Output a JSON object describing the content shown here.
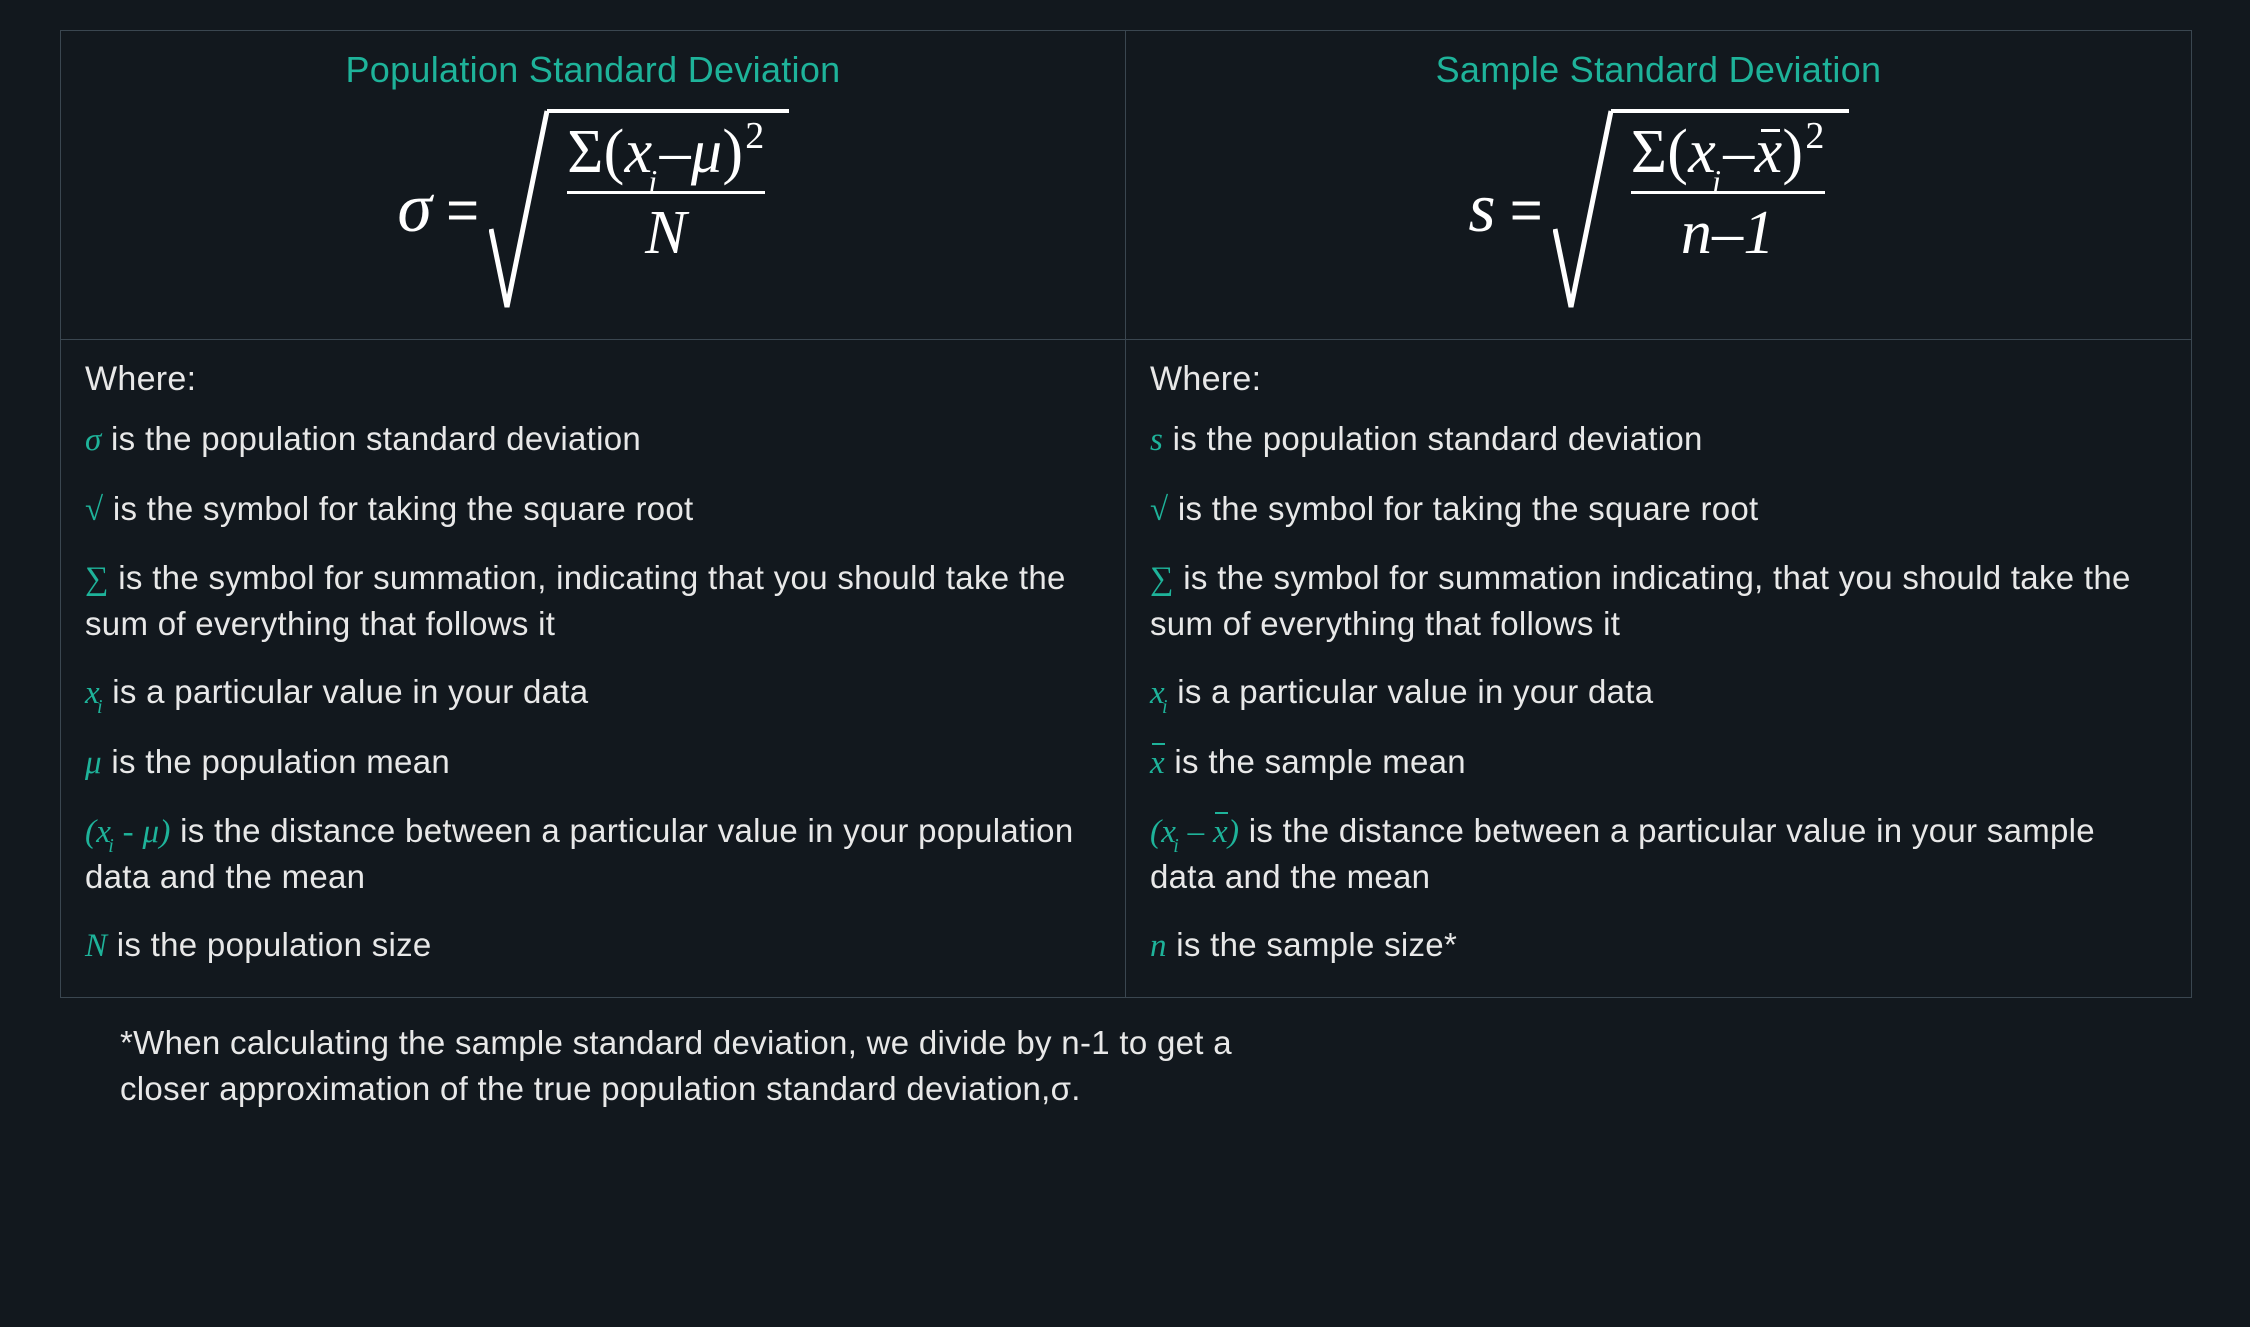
{
  "left": {
    "title": "Population Standard Deviation",
    "formula": {
      "lhs": "σ",
      "eq": "=",
      "numerator_prefix": "Σ(",
      "numerator_var": "x",
      "numerator_sub": "i",
      "numerator_mid": "–",
      "numerator_mean": "μ",
      "numerator_close": ")",
      "numerator_sup": "2",
      "denominator": "N"
    },
    "where_label": "Where:",
    "definitions": [
      {
        "symbol_html": "σ",
        "text": " is the population standard deviation"
      },
      {
        "symbol_html": "√",
        "text": " is the symbol for taking the square root"
      },
      {
        "symbol_html": "∑",
        "text": " is the symbol for summation, indicating that you should take the sum of everything that follows it"
      },
      {
        "symbol_html": "x<sub>i</sub>",
        "text": " is a particular value in your data"
      },
      {
        "symbol_html": "μ",
        "text": " is the population mean"
      },
      {
        "symbol_html": "(x<sub>i</sub> - μ)",
        "text": " is the distance between a particular value in your population data and the mean"
      },
      {
        "symbol_html": "N",
        "text": " is the population size"
      }
    ]
  },
  "right": {
    "title": "Sample Standard Deviation",
    "formula": {
      "lhs": "s",
      "eq": "=",
      "numerator_prefix": "Σ(",
      "numerator_var": "x",
      "numerator_sub": "i",
      "numerator_mid": "–",
      "numerator_mean": "x̄",
      "numerator_close": ")",
      "numerator_sup": "2",
      "denominator": "n–1"
    },
    "where_label": "Where:",
    "definitions": [
      {
        "symbol_html": "s",
        "text": " is the population standard deviation"
      },
      {
        "symbol_html": "√",
        "text": " is the symbol for taking the square root"
      },
      {
        "symbol_html": "∑",
        "text": " is the symbol for summation indicating, that you should take the sum of everything that follows it"
      },
      {
        "symbol_html": "x<sub>i</sub>",
        "text": " is a particular value in your data"
      },
      {
        "symbol_html": "x̄",
        "text": " is the sample mean"
      },
      {
        "symbol_html": "(x<sub>i</sub> – x̄)",
        "text": " is the distance between a particular value in your sample data and the mean"
      },
      {
        "symbol_html": "n",
        "text": " is the sample size*"
      }
    ]
  },
  "footnote_line1": "*When calculating the sample standard deviation, we divide by n-1 to get a",
  "footnote_line2": "  closer approximation of the true population standard deviation,σ."
}
